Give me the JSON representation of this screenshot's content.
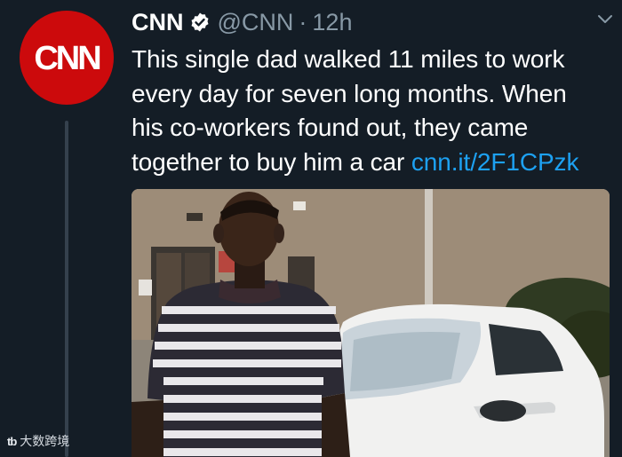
{
  "tweet": {
    "account_name": "CNN",
    "handle": "@CNN",
    "separator": "·",
    "time": "12h",
    "avatar_text": "CNN",
    "text_lines": [
      "This single dad walked 11 miles to work",
      "every day for seven long months. When",
      "his co-workers found out, they came",
      "together to buy him a car "
    ],
    "link": "cnn.it/2F1CPzk"
  },
  "watermark": {
    "logo": "tb",
    "text": "大数跨境"
  },
  "colors": {
    "background": "#141d26",
    "brand": "#cc0a0c",
    "link": "#1da1f2",
    "muted": "#8899a6"
  },
  "icons": {
    "verified": "verified-badge-icon",
    "more": "chevron-down-icon"
  }
}
